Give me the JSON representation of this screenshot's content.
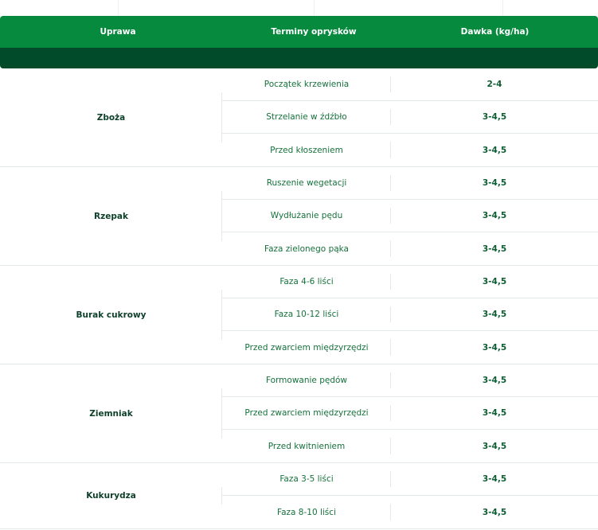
{
  "table": {
    "headers": {
      "crop": "Uprawa",
      "term": "Terminy oprysków",
      "dose": "Dawka (kg/ha)"
    },
    "groups": [
      {
        "crop": "Zboża",
        "rows": [
          {
            "term": "Początek krzewienia",
            "dose": "2-4"
          },
          {
            "term": "Strzelanie w źdźbło",
            "dose": "3-4,5"
          },
          {
            "term": "Przed kłoszeniem",
            "dose": "3-4,5"
          }
        ]
      },
      {
        "crop": "Rzepak",
        "rows": [
          {
            "term": "Ruszenie wegetacji",
            "dose": "3-4,5"
          },
          {
            "term": "Wydłużanie pędu",
            "dose": "3-4,5"
          },
          {
            "term": "Faza zielonego pąka",
            "dose": "3-4,5"
          }
        ]
      },
      {
        "crop": "Burak cukrowy",
        "rows": [
          {
            "term": "Faza 4-6 liści",
            "dose": "3-4,5"
          },
          {
            "term": "Faza 10-12 liści",
            "dose": "3-4,5"
          },
          {
            "term": "Przed zwarciem międzyrzędzi",
            "dose": "3-4,5"
          }
        ]
      },
      {
        "crop": "Ziemniak",
        "rows": [
          {
            "term": "Formowanie pędów",
            "dose": "3-4,5"
          },
          {
            "term": "Przed zwarciem międzyrzędzi",
            "dose": "3-4,5"
          },
          {
            "term": "Przed kwitnieniem",
            "dose": "3-4,5"
          }
        ]
      },
      {
        "crop": "Kukurydza",
        "rows": [
          {
            "term": "Faza 3-5 liści",
            "dose": "3-4,5"
          },
          {
            "term": "Faza 8-10 liści",
            "dose": "3-4,5"
          }
        ]
      }
    ]
  },
  "colors": {
    "header_bg": "#068a3e",
    "subheader_bg": "#014a2a",
    "crop_text": "#0e3f2a",
    "term_text": "#16713c"
  }
}
